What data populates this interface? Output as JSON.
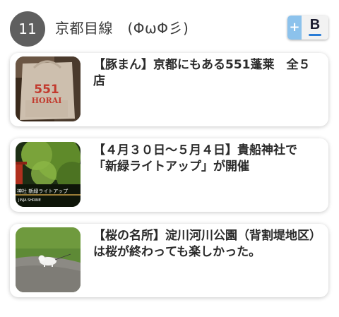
{
  "header": {
    "count": "11",
    "title": "京都目線　(ΦωΦ彡)",
    "hatena": {
      "plus_label": "+",
      "b_label": "B",
      "icon": "hatena-bookmark-icon",
      "accent_color": "#2a7cd6"
    }
  },
  "articles": [
    {
      "title": "【豚まん】京都にもある551蓬莱　全５店",
      "thumbnail": {
        "kind": "photo-paper-bag",
        "caption_top": "551",
        "caption_bottom": "HORAI"
      }
    },
    {
      "title": "【４月３０日〜５月４日】貴船神社で「新緑ライトアップ」が開催",
      "thumbnail": {
        "kind": "photo-shrine-greenery",
        "caption_top": "神社 新緑ライトアップ",
        "caption_bottom": "JINJA SHRINE"
      }
    },
    {
      "title": "【桜の名所】淀川河川公園（背割堤地区）は桜が終わっても楽しかった。",
      "thumbnail": {
        "kind": "photo-dog-park-path"
      }
    }
  ]
}
